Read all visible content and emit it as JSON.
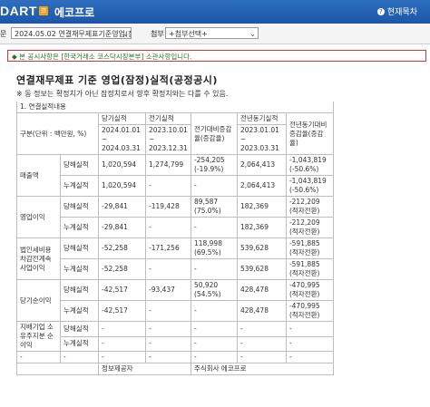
{
  "header": {
    "logo_text": "DART",
    "badge": "코",
    "app_title": "에코프로",
    "help_label": "현재목차"
  },
  "filter": {
    "report_label": "문",
    "report_value": "2024.05.02  연결재무제표기준영업(잠정)",
    "attach_label": "첨부",
    "attach_value": "+첨부선택+"
  },
  "notice": "◆ 본 공시사항은 [한국거래소 코스닥시장본부] 소관사항입니다.",
  "document": {
    "title": "연결재무제표 기준 영업(잠정)실적(공정공시)",
    "note": "※ 동 정보는 확정치가 아닌 잠정치로서 향후 확정치와는 다를 수 있음.",
    "section": "1. 연결실적내용",
    "unit_label": "구분(단위 : 백만원, %)",
    "col_current": "당기실적",
    "col_current_period": [
      "2024.01.01",
      "~",
      "2024.03.31"
    ],
    "col_prev": "전기실적",
    "col_prev_period": [
      "2023.10.01",
      "~",
      "2023.12.31"
    ],
    "col_qoq": "전기대비증감율(증감율)",
    "col_yoy": "전년동기실적",
    "col_yoy_period": [
      "2023.01.01",
      "~",
      "2023.03.31"
    ],
    "col_yoy_change": "전년동기대비증감율(증감율)",
    "rows": [
      {
        "item": "매출액",
        "sub": "당해실적",
        "cur": "1,020,594",
        "prev": "1,274,799",
        "qoq": "-254,205",
        "qoq2": "(-19.9%)",
        "yoy": "2,064,413",
        "yoyc": "-1,043,819",
        "yoyc2": "(-50.6%)"
      },
      {
        "item": "",
        "sub": "누계실적",
        "cur": "1,020,594",
        "prev": "-",
        "qoq": "-",
        "qoq2": "",
        "yoy": "2,064,413",
        "yoyc": "-1,043,819",
        "yoyc2": "(-50.6%)"
      },
      {
        "item": "영업이익",
        "sub": "당해실적",
        "cur": "-29,841",
        "prev": "-119,428",
        "qoq": "89,587",
        "qoq2": "(75.0%)",
        "yoy": "182,369",
        "yoyc": "-212,209",
        "yoyc2": "(적자전환)"
      },
      {
        "item": "",
        "sub": "누계실적",
        "cur": "-29,841",
        "prev": "-",
        "qoq": "-",
        "qoq2": "",
        "yoy": "182,369",
        "yoyc": "-212,209",
        "yoyc2": "(적자전환)"
      },
      {
        "item": "법인세비용차감전계속사업이익",
        "sub": "당해실적",
        "cur": "-52,258",
        "prev": "-171,256",
        "qoq": "118,998",
        "qoq2": "(69.5%)",
        "yoy": "539,628",
        "yoyc": "-591,885",
        "yoyc2": "(적자전환)"
      },
      {
        "item": "",
        "sub": "누계실적",
        "cur": "-52,258",
        "prev": "-",
        "qoq": "-",
        "qoq2": "",
        "yoy": "539,628",
        "yoyc": "-591,885",
        "yoyc2": "(적자전환)"
      },
      {
        "item": "당기순이익",
        "sub": "당해실적",
        "cur": "-42,517",
        "prev": "-93,437",
        "qoq": "50,920",
        "qoq2": "(54.5%)",
        "yoy": "428,478",
        "yoyc": "-470,995",
        "yoyc2": "(적자전환)"
      },
      {
        "item": "",
        "sub": "누계실적",
        "cur": "-42,517",
        "prev": "-",
        "qoq": "-",
        "qoq2": "",
        "yoy": "428,478",
        "yoyc": "-470,995",
        "yoyc2": "(적자전환)"
      },
      {
        "item": "지배기업 소유주지분 순이익",
        "sub": "당해실적",
        "cur": "-",
        "prev": "-",
        "qoq": "-",
        "qoq2": "",
        "yoy": "-",
        "yoyc": "-",
        "yoyc2": ""
      },
      {
        "item": "",
        "sub": "누계실적",
        "cur": "-",
        "prev": "-",
        "qoq": "-",
        "qoq2": "",
        "yoy": "-",
        "yoyc": "-",
        "yoyc2": ""
      },
      {
        "item": "-",
        "sub": "-",
        "cur": "-",
        "prev": "-",
        "qoq": "-",
        "qoq2": "",
        "yoy": "-",
        "yoyc": "-",
        "yoyc2": ""
      }
    ],
    "footer_left": "정보제공자",
    "footer_right": "주식회사 에코프로"
  }
}
